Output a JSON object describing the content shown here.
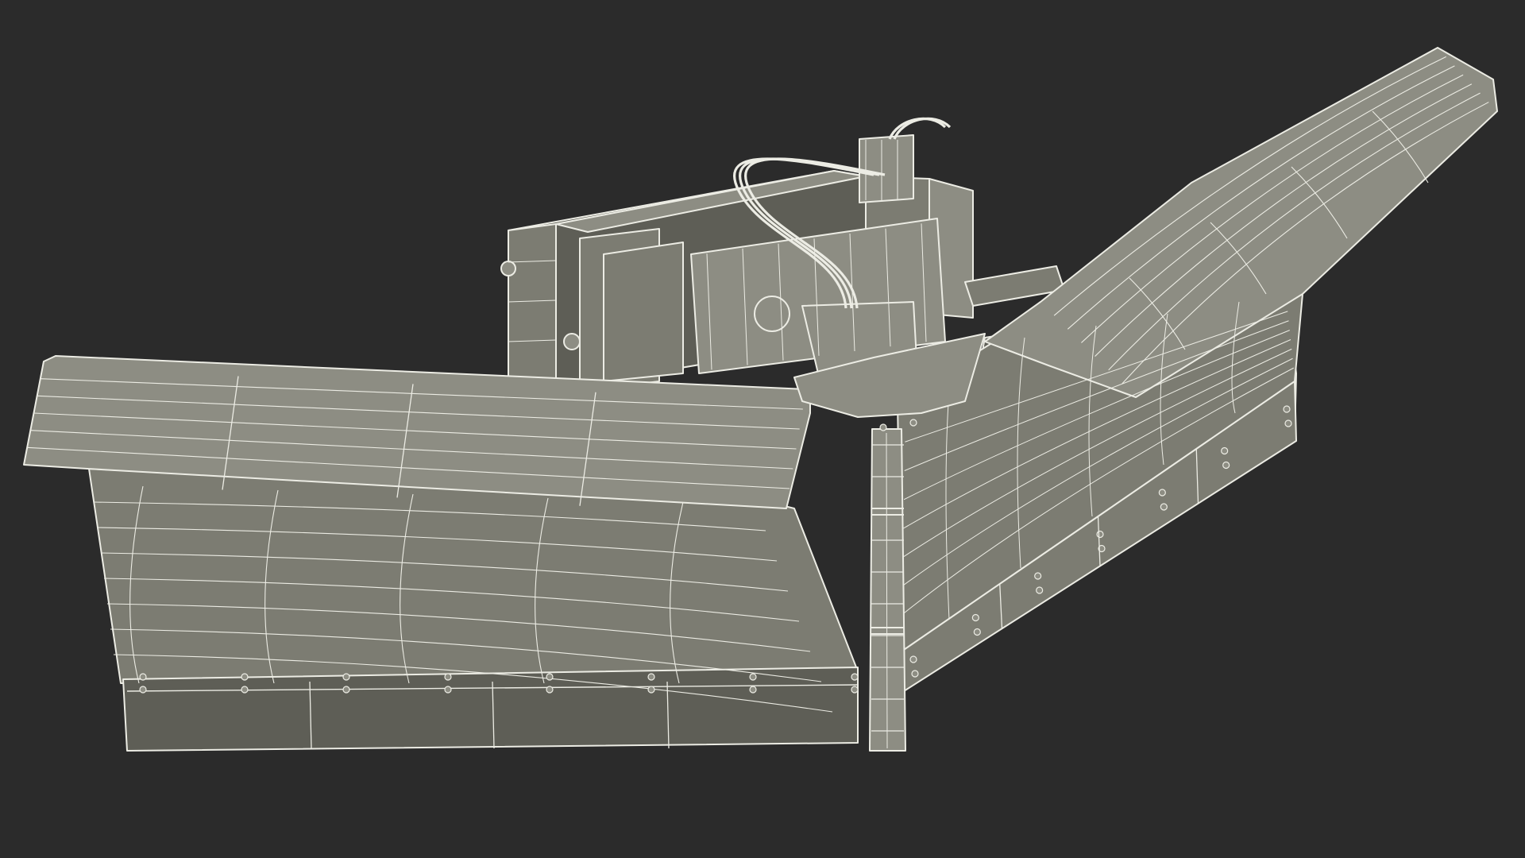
{
  "scene": {
    "subject": "v-plow-wireframe",
    "colors": {
      "background": "#2b2b2b",
      "surface": "#7c7c72",
      "surface_light": "#8d8d83",
      "surface_dark": "#5e5e56",
      "wire": "#ecece4",
      "edge": "#44443e"
    }
  }
}
